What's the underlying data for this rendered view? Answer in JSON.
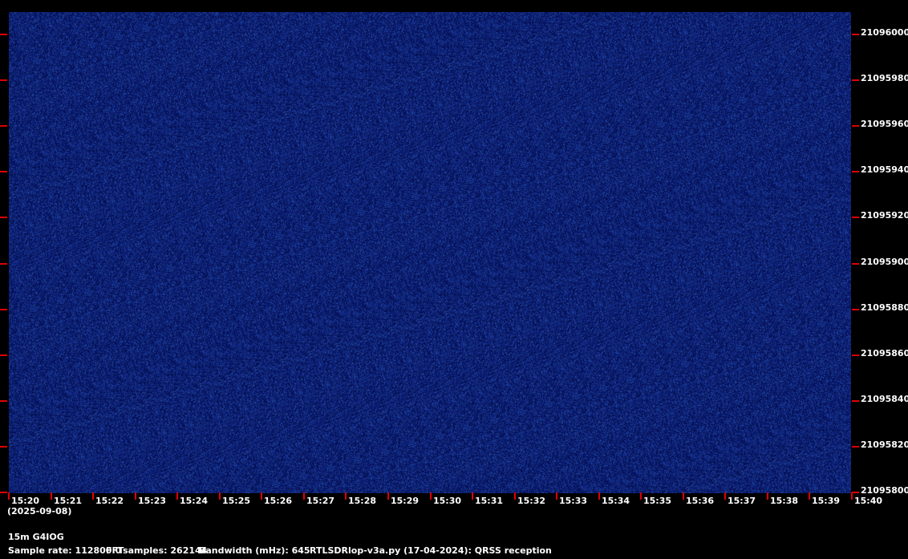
{
  "date_label": "(2025-09-08)",
  "station": "15m G4IOG",
  "footer": {
    "sample_rate": "Sample rate: 112800.0",
    "fft_samples": "FFTsamples: 262144",
    "bandwidth": "Bandwidth (mHz): 645",
    "program": "RTLSDRlop-v3a.py (17-04-2024): QRSS reception"
  },
  "colors": {
    "background": "#000000",
    "spectrogram_base": "#0e1f5e",
    "tick": "#e00000",
    "text": "#ffffff"
  },
  "chart_data": {
    "type": "heatmap",
    "x_tick_labels": [
      "15:20",
      "15:21",
      "15:22",
      "15:23",
      "15:24",
      "15:25",
      "15:26",
      "15:27",
      "15:28",
      "15:29",
      "15:30",
      "15:31",
      "15:32",
      "15:33",
      "15:34",
      "15:35",
      "15:36",
      "15:37",
      "15:38",
      "15:39",
      "15:40"
    ],
    "y_tick_labels": [
      "21096000",
      "21095980",
      "21095960",
      "21095940",
      "21095920",
      "21095900",
      "21095880",
      "21095860",
      "21095840",
      "21095820",
      "21095800"
    ],
    "ylim": [
      21095800,
      21096000
    ],
    "xlim": [
      "15:20",
      "15:40"
    ],
    "grid": false
  }
}
